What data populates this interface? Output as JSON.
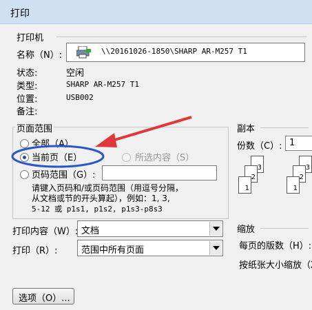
{
  "window": {
    "title": "打印"
  },
  "printer": {
    "group_label": "打印机",
    "name_label": "名称（N）:",
    "name_value": "\\\\20161026-1850\\SHARP AR-M257 T1",
    "status_label": "状态:",
    "status_value": "空闲",
    "type_label": "类型:",
    "type_value": "SHARP AR-M257 T1",
    "where_label": "位置:",
    "where_value": "USB002",
    "comment_label": "备注:",
    "comment_value": ""
  },
  "page_range": {
    "group_label": "页面范围",
    "all_label": "全部（A）",
    "current_label": "当前页（E）",
    "selection_label": "所选内容（S）",
    "pages_label": "页码范围（G）:",
    "pages_value": "",
    "hint_lines": [
      "请键入页码和/或页码范围（用逗号分隔，",
      "从文档或节的开头算起），例如：1, 3,",
      "5-12 或 p1s1, p1s2, p1s3-p8s3"
    ]
  },
  "copies": {
    "group_label": "副本",
    "count_label": "份数（C）:",
    "count_value": "1",
    "collate_pages": [
      "1",
      "2",
      "3"
    ]
  },
  "print_what": {
    "label": "打印内容（W）:",
    "value": "文档"
  },
  "print_pages": {
    "label": "打印（R）:",
    "value": "范围中所有页面"
  },
  "zoom": {
    "group_label": "缩放",
    "pages_per_sheet_label": "每页的版数（H）:",
    "scale_label": "按纸张大小缩放（Z）"
  },
  "buttons": {
    "options_label": "选项（O）..."
  },
  "colors": {
    "annotation_red": "#e0383a",
    "annotation_blue": "#2c56c8",
    "titlebar": "#cfe0f3"
  }
}
